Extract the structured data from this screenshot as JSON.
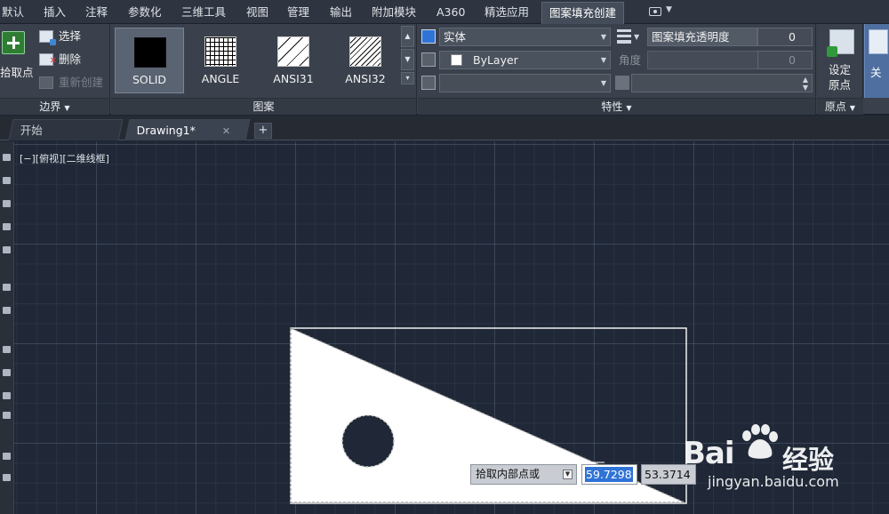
{
  "menu": {
    "items": [
      "默认",
      "插入",
      "注释",
      "参数化",
      "三维工具",
      "视图",
      "管理",
      "输出",
      "附加模块",
      "A360",
      "精选应用",
      "图案填充创建"
    ],
    "active_index": 11
  },
  "ribbon": {
    "boundary": {
      "pick_label": "拾取点",
      "select_label": "选择",
      "remove_label": "删除",
      "recreate_label": "重新创建",
      "title": "边界"
    },
    "pattern": {
      "swatches": [
        "SOLID",
        "ANGLE",
        "ANSI31",
        "ANSI32"
      ],
      "selected": "SOLID",
      "title": "图案"
    },
    "properties": {
      "hatch_type": "实体",
      "color": "ByLayer",
      "transparency_label": "图案填充透明度",
      "transparency_value": "0",
      "angle_label": "角度",
      "angle_value": "0",
      "title": "特性"
    },
    "origin": {
      "set_label_line1": "设定",
      "set_label_line2": "原点",
      "title": "原点"
    },
    "close_label": "关"
  },
  "tabs": {
    "start": "开始",
    "drawing": "Drawing1*",
    "close_glyph": "✕",
    "add_glyph": "+"
  },
  "viewport": {
    "label": "[−][俯视][二维线框]"
  },
  "command": {
    "prompt": "拾取内部点或",
    "x_value": "59.7298",
    "y_value": "53.3714"
  },
  "watermark": {
    "brand": "Bai",
    "brand_cn": "经验",
    "url": "jingyan.baidu.com"
  },
  "colors": {
    "accent": "#2f73d6",
    "canvas": "#202837",
    "hatch_fill": "#ffffff"
  }
}
